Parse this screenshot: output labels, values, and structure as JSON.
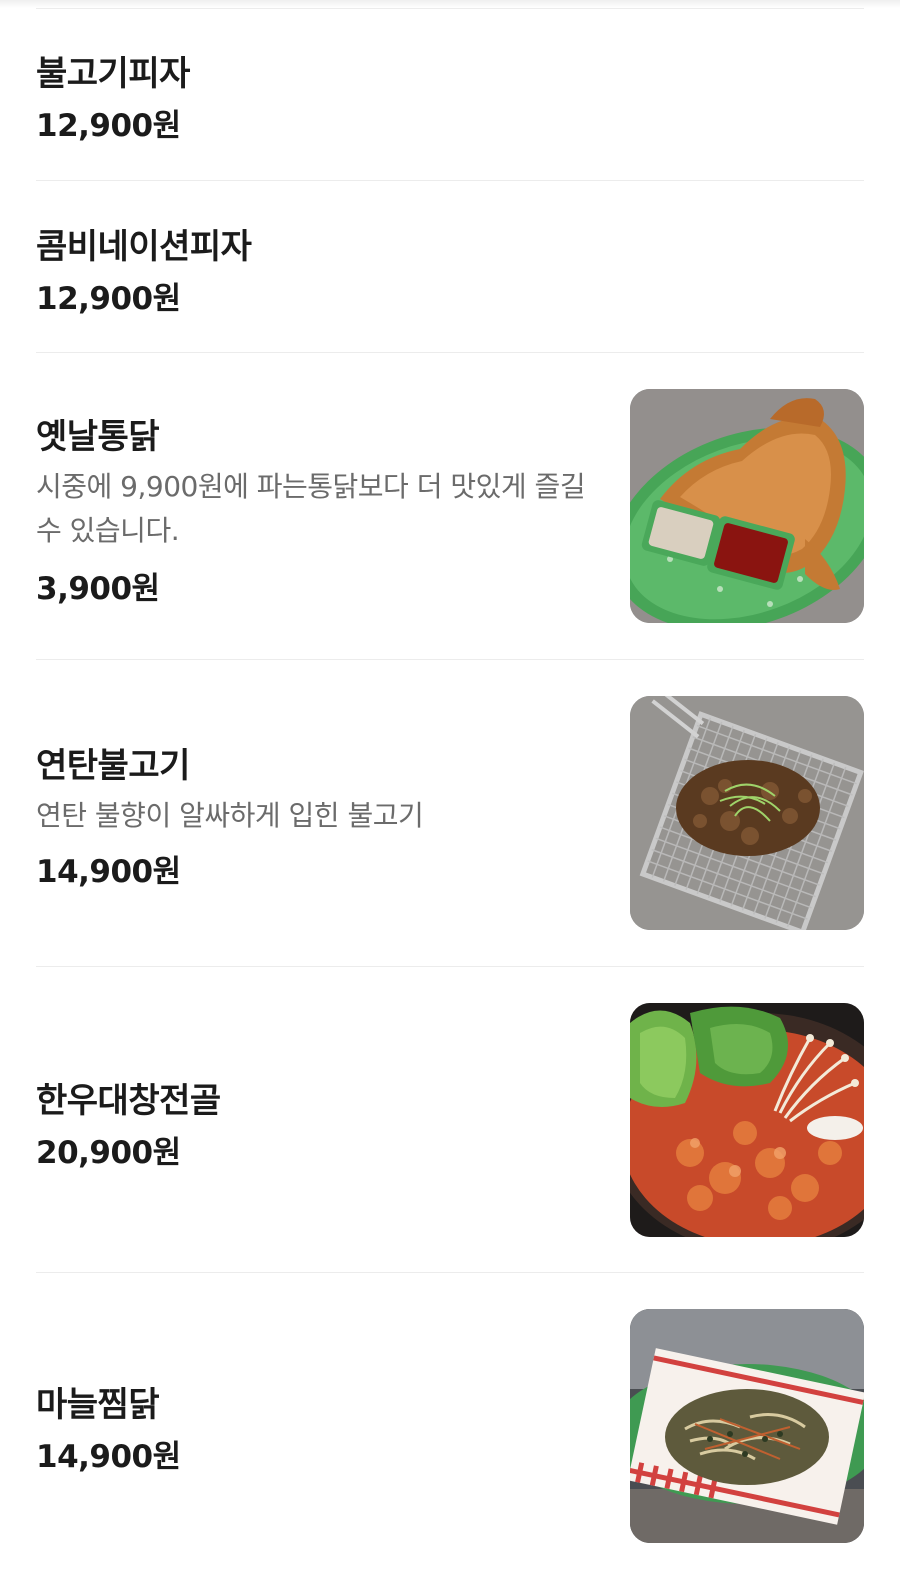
{
  "menu": {
    "items": [
      {
        "name": "불고기피자",
        "description": "",
        "price": "12,900원",
        "photo_icon": ""
      },
      {
        "name": "콤비네이션피자",
        "description": "",
        "price": "12,900원",
        "photo_icon": ""
      },
      {
        "name": "옛날통닭",
        "description": "시중에 9,900원에 파는통닭보다 더 맛있게 즐길수 있습니다.",
        "price": "3,900원",
        "photo_icon": "whole-fried-chicken-photo"
      },
      {
        "name": "연탄불고기",
        "description": "연탄 불향이 알싸하게 입힌 불고기",
        "price": "14,900원",
        "photo_icon": "grilled-bulgogi-photo"
      },
      {
        "name": "한우대창전골",
        "description": "",
        "price": "20,900원",
        "photo_icon": "beef-intestine-hotpot-photo"
      },
      {
        "name": "마늘찜닭",
        "description": "",
        "price": "14,900원",
        "photo_icon": "garlic-braised-chicken-photo"
      }
    ]
  },
  "colors": {
    "text_primary": "#1b1b1b",
    "text_secondary": "#6b6b6b",
    "divider": "#ececec",
    "background": "#ffffff"
  }
}
